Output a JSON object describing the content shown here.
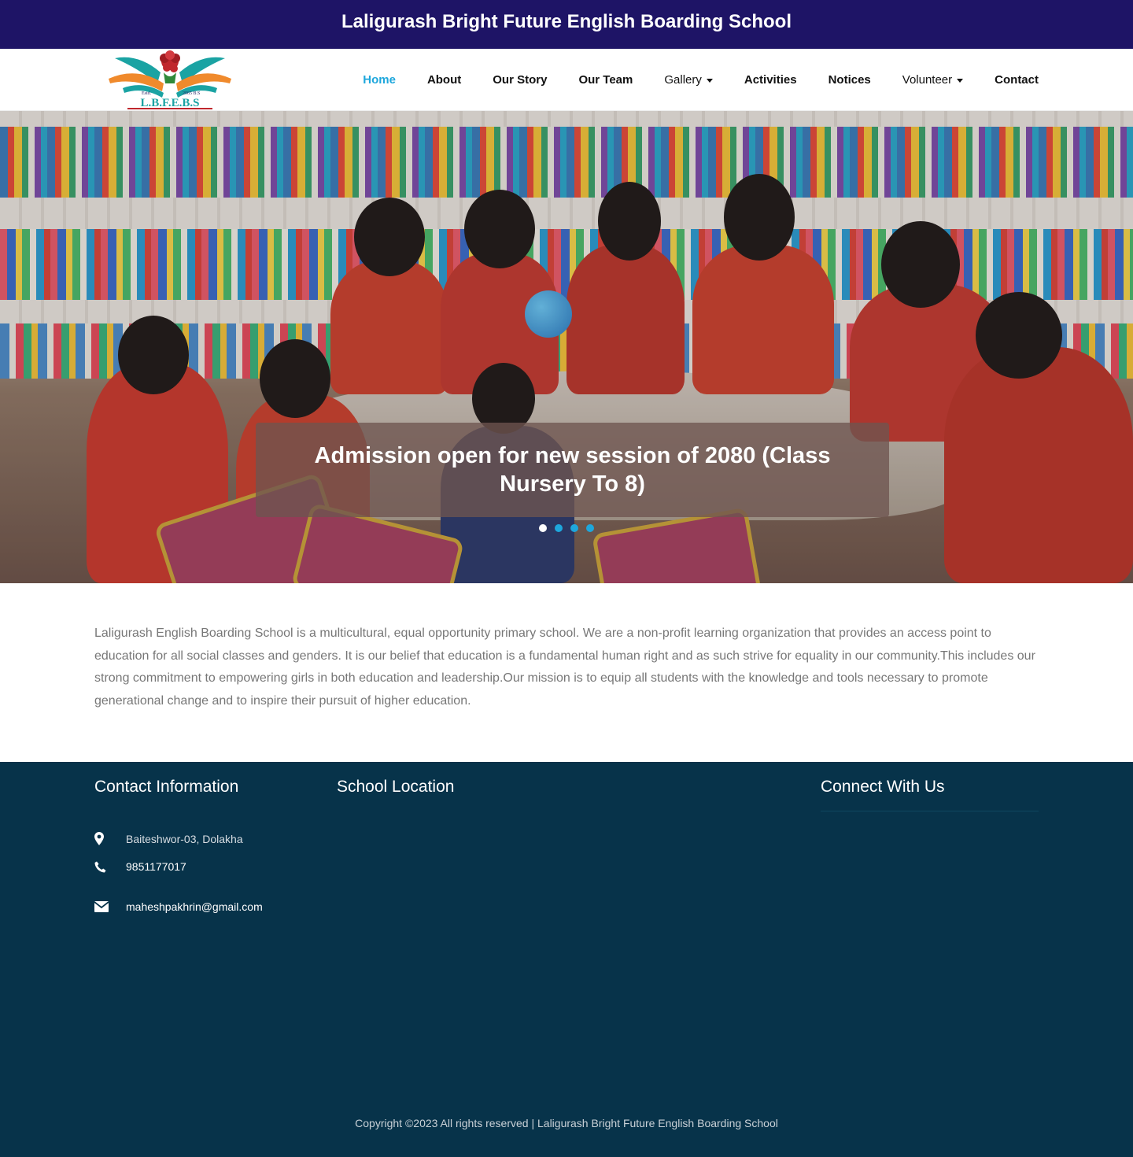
{
  "topbar": {
    "title": "Laligurash Bright Future English Boarding School"
  },
  "logo": {
    "estd": "Estd.",
    "year": "2065 B.S",
    "text": "L.B.F.E.B.S"
  },
  "nav": {
    "items": [
      {
        "label": "Home"
      },
      {
        "label": "About"
      },
      {
        "label": "Our Story"
      },
      {
        "label": "Our Team"
      },
      {
        "label": "Gallery"
      },
      {
        "label": "Activities"
      },
      {
        "label": "Notices"
      },
      {
        "label": "Volunteer"
      },
      {
        "label": "Contact"
      }
    ]
  },
  "hero": {
    "caption": "Admission open for new session of 2080 (Class Nursery To 8)",
    "active_slide": 1,
    "slide_count": 4
  },
  "about": {
    "text": "Laligurash English Boarding School is a multicultural, equal opportunity primary school. We are a non-profit learning organization that provides an access point to education for all social classes and genders. It is our belief that education is a fundamental human right and as such strive for equality in our community.This includes our strong commitment to empowering girls in both education and leadership.Our mission is to equip all students with the knowledge and tools necessary to promote generational change and to inspire their pursuit of higher education."
  },
  "footer": {
    "contact_title": "Contact Information",
    "location_title": "School Location",
    "connect_title": "Connect With Us",
    "address": "Baiteshwor-03, Dolakha",
    "phone": "9851177017",
    "email": "maheshpakhrin@gmail.com",
    "copyright": "Copyright ©2023 All rights reserved | Laligurash Bright Future English Boarding School"
  },
  "colors": {
    "topbar": "#1e1466",
    "accent": "#1ea7dc",
    "footer": "#07334a"
  }
}
